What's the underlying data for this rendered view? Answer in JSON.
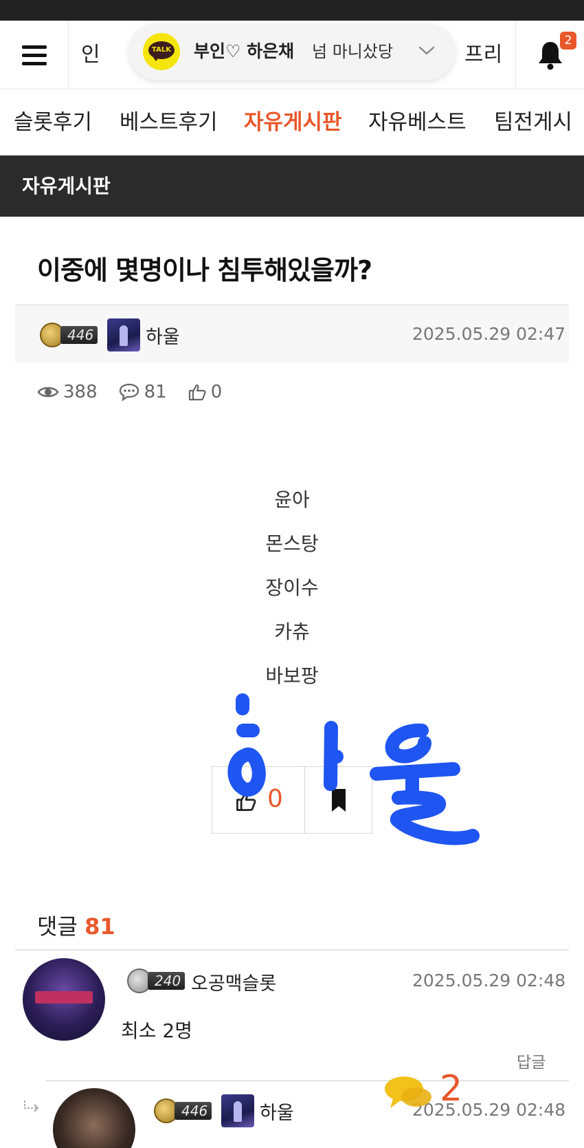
{
  "header": {
    "left_text": "인",
    "right_text": "프리",
    "notification_count": "2"
  },
  "talk_pill": {
    "icon_text": "TALK",
    "name": "부인♡ 하은채",
    "subtitle": "넘 마니샀당"
  },
  "tabs": [
    {
      "label": "슬롯후기",
      "active": false
    },
    {
      "label": "베스트후기",
      "active": false
    },
    {
      "label": "자유게시판",
      "active": true
    },
    {
      "label": "자유베스트",
      "active": false
    },
    {
      "label": "팀전게시",
      "active": false
    }
  ],
  "board": {
    "title": "자유게시판"
  },
  "post": {
    "title": "이중에 몇명이나 침투해있을까?",
    "author": {
      "level": "446",
      "name": "하울"
    },
    "date": "2025.05.29 02:47",
    "views": "388",
    "comments": "81",
    "likes": "0",
    "content": [
      "윤아",
      "몬스탕",
      "장이수",
      "카츄",
      "바보팡"
    ],
    "vote_count": "0",
    "handwriting": "하울"
  },
  "comments": {
    "label": "댓글",
    "count": "81",
    "reply_label": "답글",
    "items": [
      {
        "level": "240",
        "name": "오공맥슬롯",
        "date": "2025.05.29 02:48",
        "text": "최소 2명"
      },
      {
        "level": "446",
        "name": "하울",
        "date": "2025.05.29 02:48"
      }
    ],
    "floating_count": "2"
  },
  "colors": {
    "accent": "#e8582b",
    "dark_bar": "#2b2b2b",
    "talk_yellow": "#f5e50d",
    "scribble_blue": "#1f55f0"
  }
}
